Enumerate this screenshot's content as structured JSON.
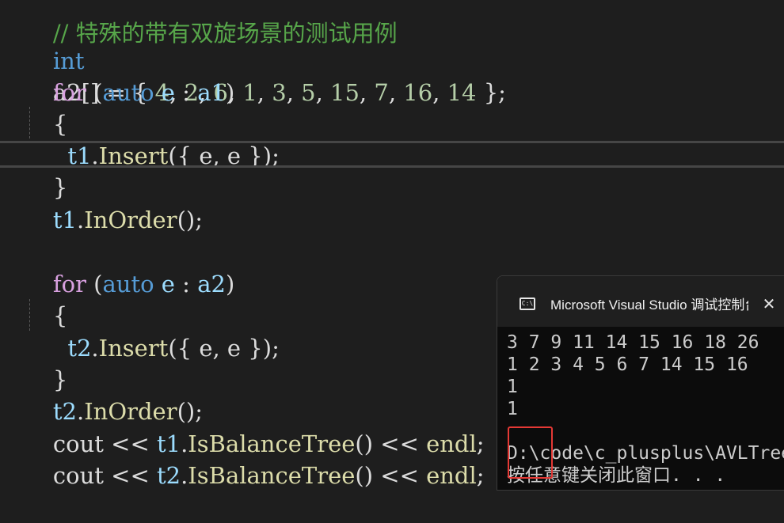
{
  "editor": {
    "comment_line": "// 特殊的带有双旋场景的测试用例",
    "array_decl": {
      "type_kw": "int",
      "name": "a2",
      "brackets": "[] = { ",
      "values": [
        "4",
        "2",
        "6",
        "1",
        "3",
        "5",
        "15",
        "7",
        "16",
        "14"
      ],
      "close": " };"
    },
    "loop1": {
      "for_kw": "for",
      "open": " (",
      "auto_kw": "auto",
      "var": " e",
      "colon": " : ",
      "range": "a1",
      "close": ")"
    },
    "brace_open": "{",
    "brace_close": "}",
    "insert1": {
      "obj": "t1",
      "dot": ".",
      "fn": "Insert",
      "args": "({ e, e });"
    },
    "inorder1": {
      "obj": "t1",
      "dot": ".",
      "fn": "InOrder",
      "tail": "();"
    },
    "loop2": {
      "for_kw": "for",
      "open": " (",
      "auto_kw": "auto",
      "var": " e",
      "colon": " : ",
      "range": "a2",
      "close": ")"
    },
    "insert2": {
      "obj": "t2",
      "dot": ".",
      "fn": "Insert",
      "args": "({ e, e });"
    },
    "inorder2": {
      "obj": "t2",
      "dot": ".",
      "fn": "InOrder",
      "tail": "();"
    },
    "cout1": {
      "cout": "cout",
      "op": " << ",
      "obj": "t1",
      "dot": ".",
      "fn": "IsBalanceTree",
      "tail": "() << ",
      "endl": "endl",
      "semi": ";"
    },
    "cout2": {
      "cout": "cout",
      "op": " << ",
      "obj": "t2",
      "dot": ".",
      "fn": "IsBalanceTree",
      "tail": "() << ",
      "endl": "endl",
      "semi": ";"
    }
  },
  "console": {
    "icon_text": "C:\\",
    "title": "Microsoft Visual Studio 调试控制台",
    "close_glyph": "✕",
    "output": [
      "3 7 9 11 14 15 16 18 26",
      "1 2 3 4 5 6 7 14 15 16",
      "1",
      "1",
      "",
      "D:\\code\\c_plusplus\\AVLTree",
      "按任意键关闭此窗口. . ."
    ],
    "highlight_color": "#e53935"
  },
  "colors": {
    "background": "#1e1e1e",
    "keyword": "#569cd6",
    "control": "#d8a0df",
    "number": "#b5cea8",
    "variable": "#9cdcfe",
    "function": "#dcdcaa",
    "comment": "#57a64a"
  }
}
